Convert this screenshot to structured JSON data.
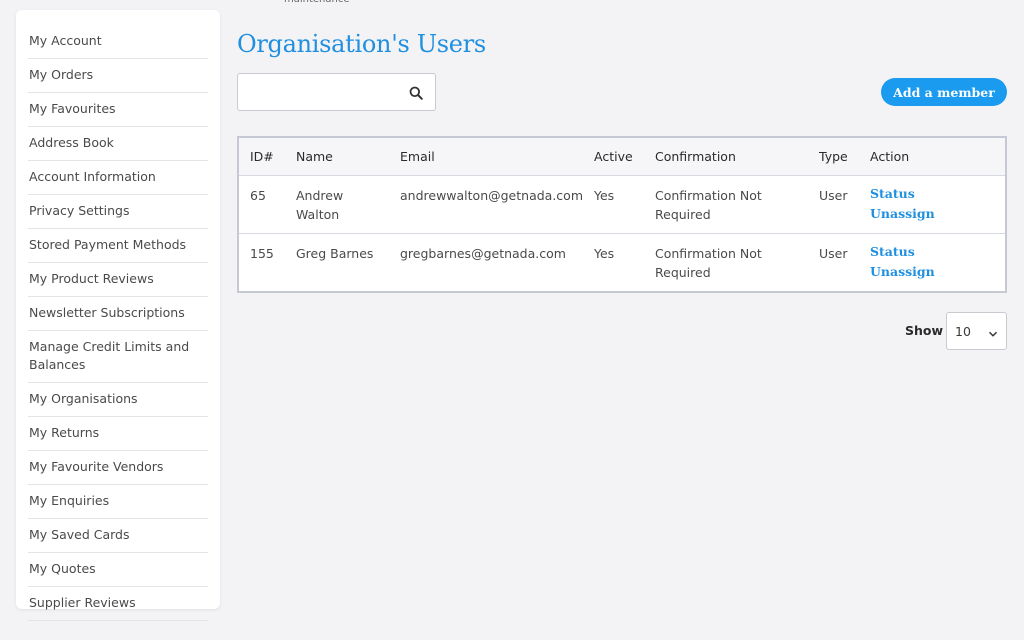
{
  "top_cut_text": "maintenance",
  "sidebar": {
    "items": [
      {
        "label": "My Account"
      },
      {
        "label": "My Orders"
      },
      {
        "label": "My Favourites"
      },
      {
        "label": "Address Book"
      },
      {
        "label": "Account Information"
      },
      {
        "label": "Privacy Settings"
      },
      {
        "label": "Stored Payment Methods"
      },
      {
        "label": "My Product Reviews"
      },
      {
        "label": "Newsletter Subscriptions"
      },
      {
        "label": "Manage Credit Limits and Balances"
      },
      {
        "label": "My Organisations"
      },
      {
        "label": "My Returns"
      },
      {
        "label": "My Favourite Vendors"
      },
      {
        "label": "My Enquiries"
      },
      {
        "label": "My Saved Cards"
      },
      {
        "label": "My Quotes"
      },
      {
        "label": "Supplier Reviews"
      }
    ]
  },
  "main": {
    "title": "Organisation's Users",
    "search": {
      "value": "",
      "placeholder": "",
      "icon": "search-icon"
    },
    "add_button": "Add a member",
    "table": {
      "headers": [
        "ID#",
        "Name",
        "Email",
        "Active",
        "Confirmation",
        "Type",
        "Action"
      ],
      "rows": [
        {
          "id": "65",
          "name": "Andrew Walton",
          "email": "andrewwalton@getnada.com",
          "active": "Yes",
          "confirmation": "Confirmation Not Required",
          "type": "User",
          "action_status": "Status",
          "action_unassign": "Unassign"
        },
        {
          "id": "155",
          "name": "Greg Barnes",
          "email": "gregbarnes@getnada.com",
          "active": "Yes",
          "confirmation": "Confirmation Not Required",
          "type": "User",
          "action_status": "Status",
          "action_unassign": "Unassign"
        }
      ]
    },
    "pagination": {
      "show_label": "Show",
      "show_value": "10"
    }
  },
  "colors": {
    "accent": "#1f8fe0",
    "button": "#1a9bf0",
    "background": "#f3f3f6"
  }
}
